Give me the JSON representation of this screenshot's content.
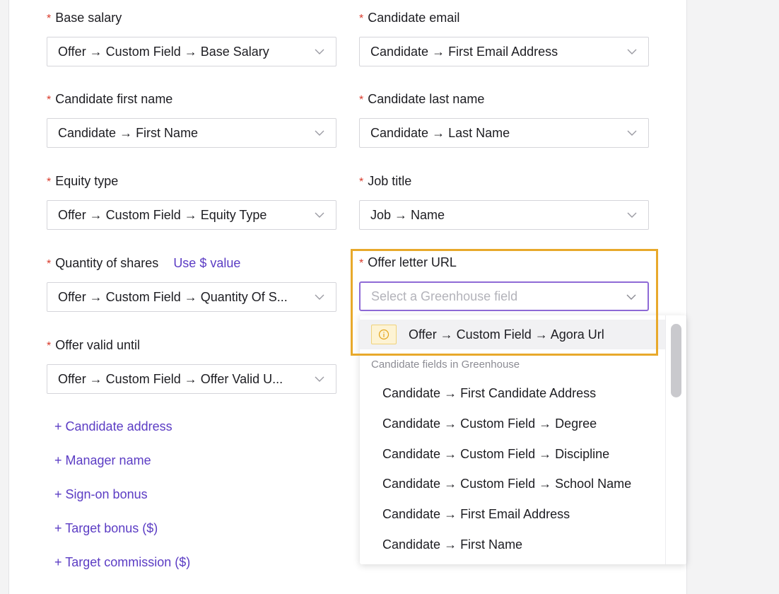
{
  "fields": {
    "base_salary": {
      "label": "Base salary",
      "value": "Offer → Custom Field → Base Salary"
    },
    "candidate_email": {
      "label": "Candidate email",
      "value": "Candidate → First Email Address"
    },
    "candidate_first_name": {
      "label": "Candidate first name",
      "value": "Candidate → First Name"
    },
    "candidate_last_name": {
      "label": "Candidate last name",
      "value": "Candidate → Last Name"
    },
    "equity_type": {
      "label": "Equity type",
      "value": "Offer → Custom Field → Equity Type"
    },
    "job_title": {
      "label": "Job title",
      "value": "Job → Name"
    },
    "quantity_of_shares": {
      "label": "Quantity of shares",
      "value": "Offer → Custom Field → Quantity Of S...",
      "alt_link": "Use $ value"
    },
    "offer_letter_url": {
      "label": "Offer letter URL",
      "placeholder": "Select a Greenhouse field"
    },
    "offer_valid_until": {
      "label": "Offer valid until",
      "value": "Offer → Custom Field → Offer Valid U..."
    }
  },
  "required_marker": "*",
  "add_links": [
    "+ Candidate address",
    "+ Manager name",
    "+ Sign-on bonus",
    "+ Target bonus ($)",
    "+ Target commission ($)"
  ],
  "dropdown": {
    "suggested": "Offer → Custom Field → Agora Url",
    "group_label": "Candidate fields in Greenhouse",
    "options": [
      "Candidate → First Candidate Address",
      "Candidate → Custom Field → Degree",
      "Candidate → Custom Field → Discipline",
      "Candidate → Custom Field → School Name",
      "Candidate → First Email Address",
      "Candidate → First Name"
    ]
  },
  "colors": {
    "accent": "#5b3cc4",
    "required": "#d93a2b",
    "highlight": "#e8a92b",
    "focus": "#8e6ad6"
  }
}
